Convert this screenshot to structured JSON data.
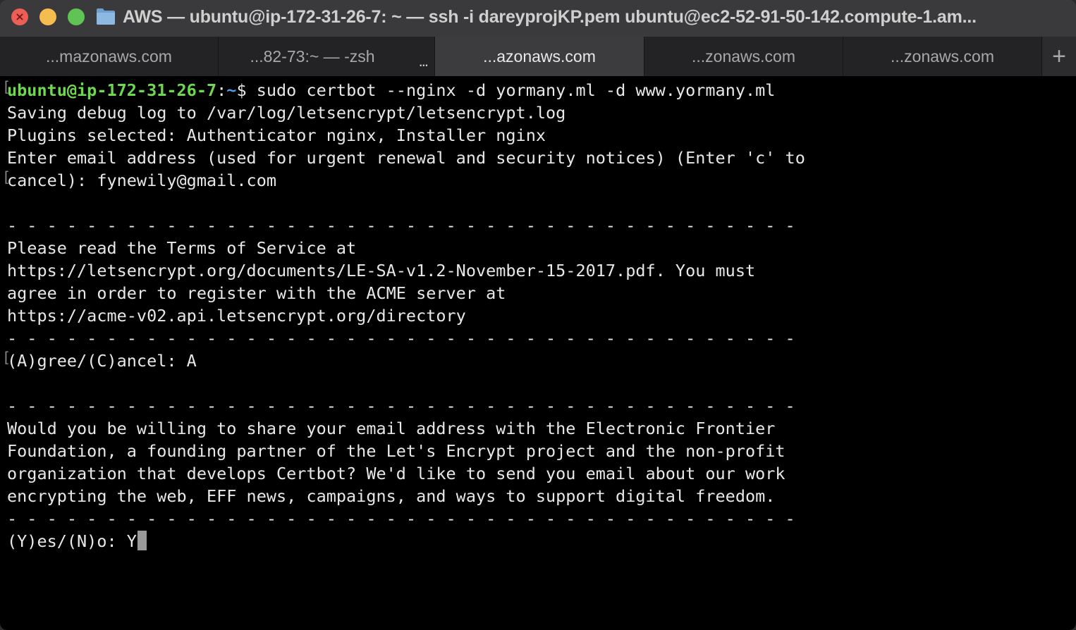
{
  "window": {
    "title": "AWS — ubuntu@ip-172-31-26-7: ~ — ssh -i dareyprojKP.pem ubuntu@ec2-52-91-50-142.compute-1.am...",
    "traffic_close": "×"
  },
  "tabs": [
    {
      "label": "...mazonaws.com",
      "active": false
    },
    {
      "label": "...82-73:~ — -zsh",
      "active": false,
      "dots": "..."
    },
    {
      "label": "...azonaws.com",
      "active": true
    },
    {
      "label": "...zonaws.com",
      "active": false
    },
    {
      "label": "...zonaws.com",
      "active": false
    }
  ],
  "new_tab": "+",
  "terminal": {
    "prompt": {
      "user_host": "ubuntu@ip-172-31-26-7",
      "colon": ":",
      "path": "~",
      "symbol": "$ ",
      "command": "sudo certbot --nginx -d yormany.ml -d www.yormany.ml"
    },
    "lines": [
      "Saving debug log to /var/log/letsencrypt/letsencrypt.log",
      "Plugins selected: Authenticator nginx, Installer nginx",
      "Enter email address (used for urgent renewal and security notices) (Enter 'c' to",
      "cancel): fynewily@gmail.com",
      "",
      "- - - - - - - - - - - - - - - - - - - - - - - - - - - - - - - - - - - - - - - -",
      "Please read the Terms of Service at",
      "https://letsencrypt.org/documents/LE-SA-v1.2-November-15-2017.pdf. You must",
      "agree in order to register with the ACME server at",
      "https://acme-v02.api.letsencrypt.org/directory",
      "- - - - - - - - - - - - - - - - - - - - - - - - - - - - - - - - - - - - - - - -",
      "(A)gree/(C)ancel: A",
      "",
      "- - - - - - - - - - - - - - - - - - - - - - - - - - - - - - - - - - - - - - - -",
      "Would you be willing to share your email address with the Electronic Frontier",
      "Foundation, a founding partner of the Let's Encrypt project and the non-profit",
      "organization that develops Certbot? We'd like to send you email about our work",
      "encrypting the web, EFF news, campaigns, and ways to support digital freedom.",
      "- - - - - - - - - - - - - - - - - - - - - - - - - - - - - - - - - - - - - - - -"
    ],
    "input_line": "(Y)es/(N)o: Y",
    "marker": "["
  },
  "colors": {
    "prompt_user": "#6dd94d",
    "prompt_path": "#4c9fe8",
    "text": "#e8e8e8",
    "background": "#000000"
  }
}
